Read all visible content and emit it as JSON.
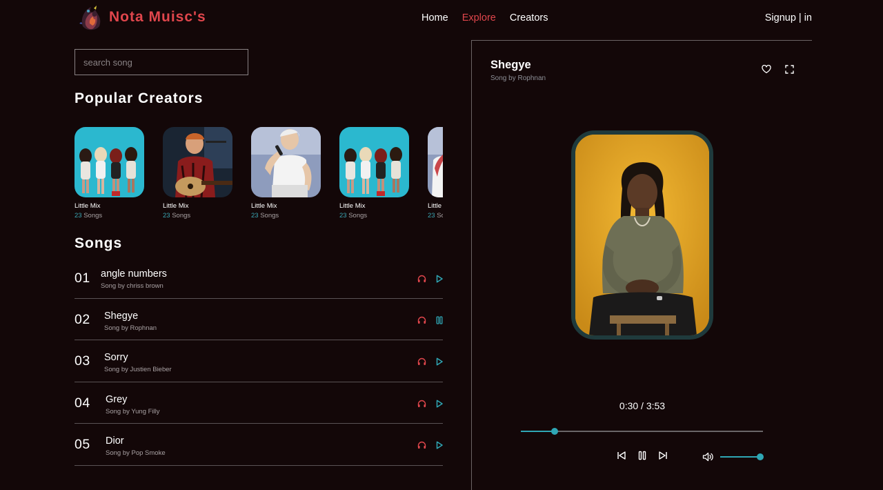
{
  "colors": {
    "background": "#130708",
    "accent_red": "#e0464c",
    "accent_teal": "#2fa7b5",
    "muted_text": "#a9a2a4",
    "divider": "#5b5355"
  },
  "header": {
    "brand": "Nota Muisc's",
    "logo_icon": "abstract-music-logo-icon",
    "nav": [
      {
        "label": "Home",
        "active": false
      },
      {
        "label": "Explore",
        "active": true
      },
      {
        "label": "Creators",
        "active": false
      }
    ],
    "auth_label": "Signup | in"
  },
  "search": {
    "placeholder": "search song",
    "value": ""
  },
  "creators_section": {
    "title": "Popular Creators",
    "items": [
      {
        "name": "Little Mix",
        "count": "23",
        "count_label": "Songs",
        "image": "group-photo"
      },
      {
        "name": "Little Mix",
        "count": "23",
        "count_label": "Songs",
        "image": "guitar-singer-photo"
      },
      {
        "name": "Little Mix",
        "count": "23",
        "count_label": "Songs",
        "image": "singer-microphone-photo"
      },
      {
        "name": "Little Mix",
        "count": "23",
        "count_label": "Songs",
        "image": "group-photo"
      },
      {
        "name": "Little Mix",
        "count": "23",
        "count_label": "Songs",
        "image": "singer-microphone-photo"
      }
    ]
  },
  "songs_section": {
    "title": "Songs",
    "items": [
      {
        "num": "01",
        "title": "angle numbers",
        "artist": "Song by chriss brown",
        "state": "play"
      },
      {
        "num": "02",
        "title": "Shegye",
        "artist": "Song by Rophnan",
        "state": "pause"
      },
      {
        "num": "03",
        "title": "Sorry",
        "artist": "Song by Justien Bieber",
        "state": "play"
      },
      {
        "num": "04",
        "title": "Grey",
        "artist": "Song by Yung Filly",
        "state": "play"
      },
      {
        "num": "05",
        "title": "Dior",
        "artist": "Song by Pop Smoke",
        "state": "play"
      }
    ]
  },
  "now_playing": {
    "title": "Shegye",
    "artist": "Song by Rophnan",
    "actions": [
      "heart-icon",
      "fullscreen-icon"
    ],
    "time_display": "0:30 / 3:53",
    "progress": 0.14,
    "volume": 1.0,
    "controls": [
      "skip-previous-icon",
      "pause-icon",
      "skip-next-icon"
    ]
  }
}
